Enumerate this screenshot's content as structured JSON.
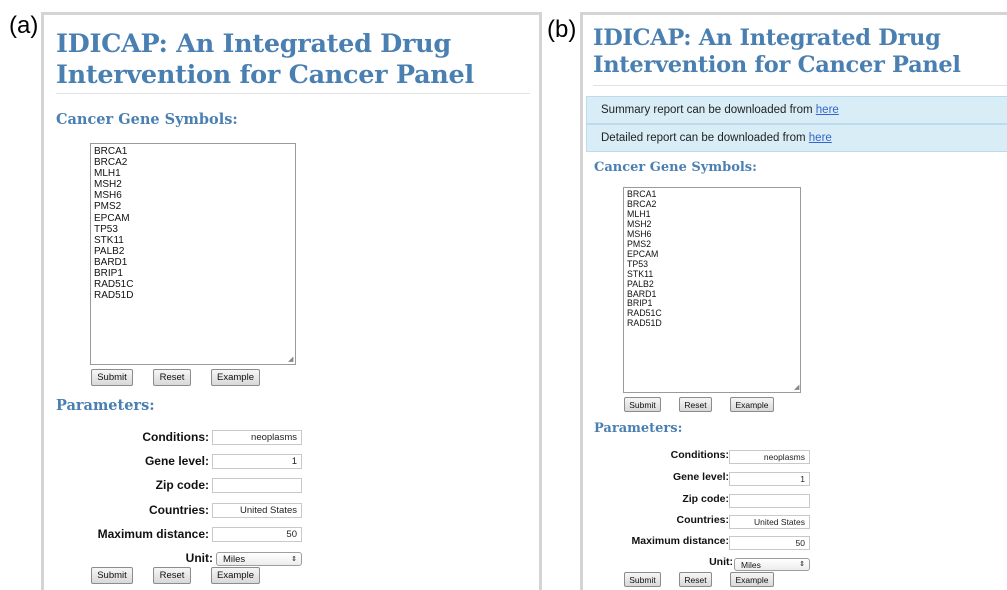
{
  "panels": {
    "a": {
      "label": "(a)"
    },
    "b": {
      "label": "(b)"
    }
  },
  "app": {
    "title": "IDICAP: An Integrated Drug Intervention for Cancer Panel"
  },
  "notices": {
    "summary_text": "Summary report can be downloaded from",
    "detailed_text": "Detailed report can be downloaded from",
    "link_text": "here"
  },
  "genes": {
    "heading": "Cancer Gene Symbols:",
    "symbols": "BRCA1\nBRCA2\nMLH1\nMSH2\nMSH6\nPMS2\nEPCAM\nTP53\nSTK11\nPALB2\nBARD1\nBRIP1\nRAD51C\nRAD51D"
  },
  "buttons": {
    "submit": "Submit",
    "reset": "Reset",
    "example": "Example"
  },
  "parameters": {
    "heading": "Parameters:",
    "conditions": {
      "label": "Conditions:",
      "value": "neoplasms"
    },
    "gene_level": {
      "label": "Gene level:",
      "value": "1"
    },
    "zip_code": {
      "label": "Zip code:",
      "value": ""
    },
    "countries": {
      "label": "Countries:",
      "value": "United States"
    },
    "max_distance": {
      "label": "Maximum distance:",
      "value": "50"
    },
    "unit": {
      "label": "Unit:",
      "value": "Miles"
    }
  },
  "icons": {
    "select_arrow": "updown-arrows-icon",
    "resize_grip": "resize-grip-icon"
  },
  "colors": {
    "heading": "#4a7fb1",
    "notice_bg": "#d9edf7",
    "link": "#3366cc"
  }
}
